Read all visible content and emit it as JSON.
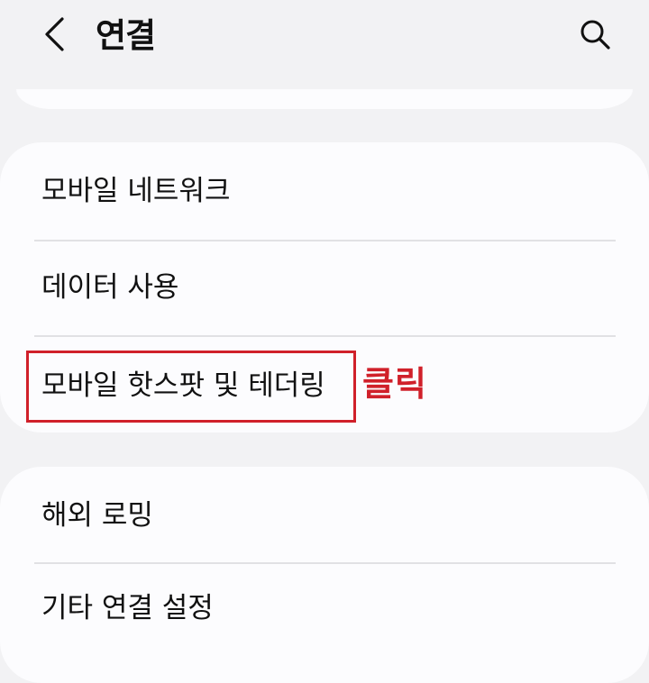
{
  "header": {
    "back_icon": "chevron-left-icon",
    "title": "연결",
    "search_icon": "search-icon"
  },
  "sections": [
    {
      "items": [
        {
          "label": "모바일 네트워크"
        },
        {
          "label": "데이터 사용"
        },
        {
          "label": "모바일 핫스팟 및 테더링"
        }
      ]
    },
    {
      "items": [
        {
          "label": "해외 로밍"
        },
        {
          "label": "기타 연결 설정"
        }
      ]
    }
  ],
  "annotation": {
    "label": "클릭",
    "color": "#d0202a"
  }
}
